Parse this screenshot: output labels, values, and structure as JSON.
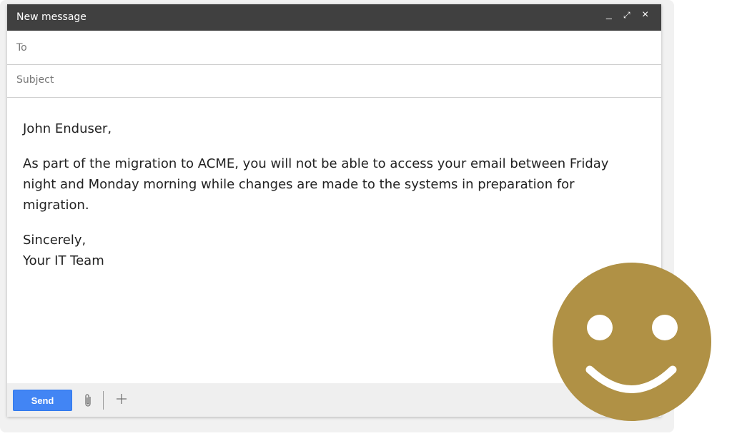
{
  "window": {
    "title": "New message",
    "controls": {
      "minimize": "_",
      "expand": "⤢",
      "close": "×"
    }
  },
  "fields": {
    "to_label": "To",
    "to_value": "",
    "subject_label": "Subject",
    "subject_value": ""
  },
  "message": {
    "greeting": "John Enduser,",
    "body": "As part of the migration to ACME, you will not be able to access your email between Friday night and Monday morning while changes are made to the systems in preparation for migration.",
    "closing": "Sincerely,",
    "signature": "Your IT Team"
  },
  "toolbar": {
    "send_label": "Send",
    "attach_icon": "paperclip-icon",
    "more_icon": "plus-icon"
  },
  "decoration": {
    "icon": "smiley-face-icon",
    "color": "#b09145"
  },
  "colors": {
    "titlebar": "#404040",
    "send_button": "#4285f4",
    "footer": "#efefef"
  }
}
